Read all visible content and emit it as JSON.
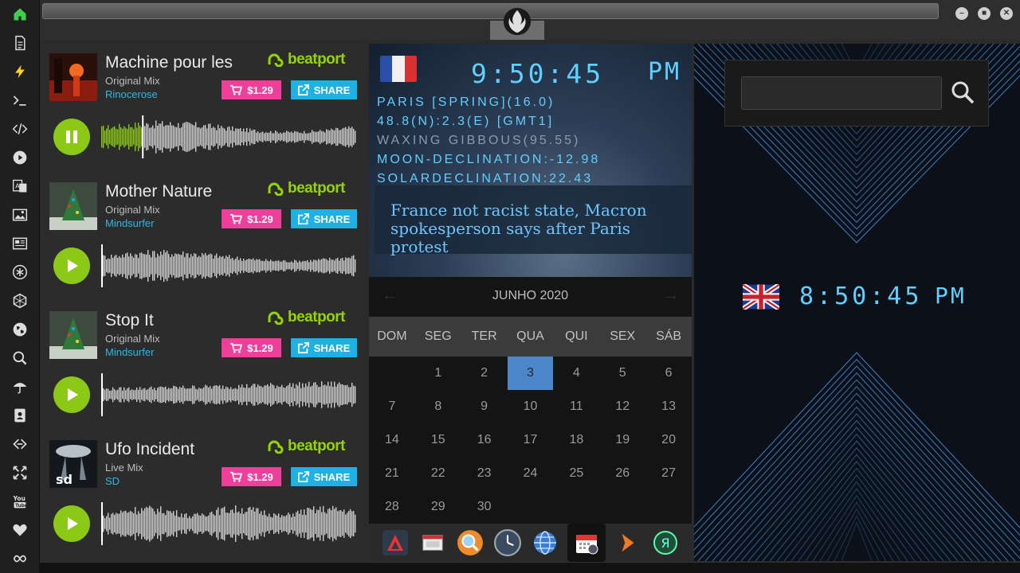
{
  "tracks": [
    {
      "title": "Machine pour les",
      "mix": "Original Mix",
      "artist": "Rinocerose",
      "price": "$1.29",
      "share": "SHARE",
      "brand": "beatport",
      "state": "playing",
      "progress": 0.16,
      "cover": "red"
    },
    {
      "title": "Mother Nature",
      "mix": "Original Mix",
      "artist": "Mindsurfer",
      "price": "$1.29",
      "share": "SHARE",
      "brand": "beatport",
      "state": "paused",
      "progress": 0,
      "cover": "tree"
    },
    {
      "title": "Stop It",
      "mix": "Original Mix",
      "artist": "Mindsurfer",
      "price": "$1.29",
      "share": "SHARE",
      "brand": "beatport",
      "state": "paused",
      "progress": 0,
      "cover": "tree"
    },
    {
      "title": "Ufo Incident",
      "mix": "Live Mix",
      "artist": "SD",
      "price": "$1.29",
      "share": "SHARE",
      "brand": "beatport",
      "state": "paused",
      "progress": 0,
      "cover": "ufo"
    }
  ],
  "clock_fr": {
    "time": "9:50:45",
    "ampm": "PM",
    "location": "PARIS [SPRING](16.0)",
    "coords": "48.8(N):2.3(E) [GMT1]",
    "moon_phase": "WAXING GIBBOUS(95.55)",
    "moon_declination": "MOON-DECLINATION:-12.98",
    "solar_declination": "SOLARDECLINATION:22.43",
    "news": "France not racist state, Macron spokesperson says after Paris protest"
  },
  "clock_uk": {
    "time": "8:50:45",
    "ampm": "PM"
  },
  "calendar": {
    "month_label": "JUNHO 2020",
    "weekdays": [
      "DOM",
      "SEG",
      "TER",
      "QUA",
      "QUI",
      "SEX",
      "SÁB"
    ],
    "start_offset": 1,
    "days": 30,
    "today": 3
  },
  "colors": {
    "accent_green": "#8cc816",
    "beatport_green": "#94d500",
    "price_pink": "#ee3f9b",
    "share_blue": "#1fb1e5",
    "lcd_cyan": "#5fd0ff",
    "today_blue": "#4a86c8"
  },
  "rail_icons": [
    "home-icon",
    "document-icon",
    "lightning-icon",
    "terminal-icon",
    "code-icon",
    "play-circle-icon",
    "translate-icon",
    "image-icon",
    "newspaper-icon",
    "asterisk-icon",
    "hexagon-icon",
    "globe-icon",
    "search-icon",
    "umbrella-icon",
    "contact-icon",
    "link-icon",
    "expand-icon",
    "youtube-icon",
    "heart-icon",
    "infinity-icon"
  ],
  "dock_apps": [
    "arch-app",
    "presentation-app",
    "magnifier-app",
    "clock-app",
    "globe-app",
    "calendar-app",
    "arrow-app",
    "yandex-app"
  ],
  "window_controls": [
    "minimize",
    "maximize",
    "close"
  ]
}
